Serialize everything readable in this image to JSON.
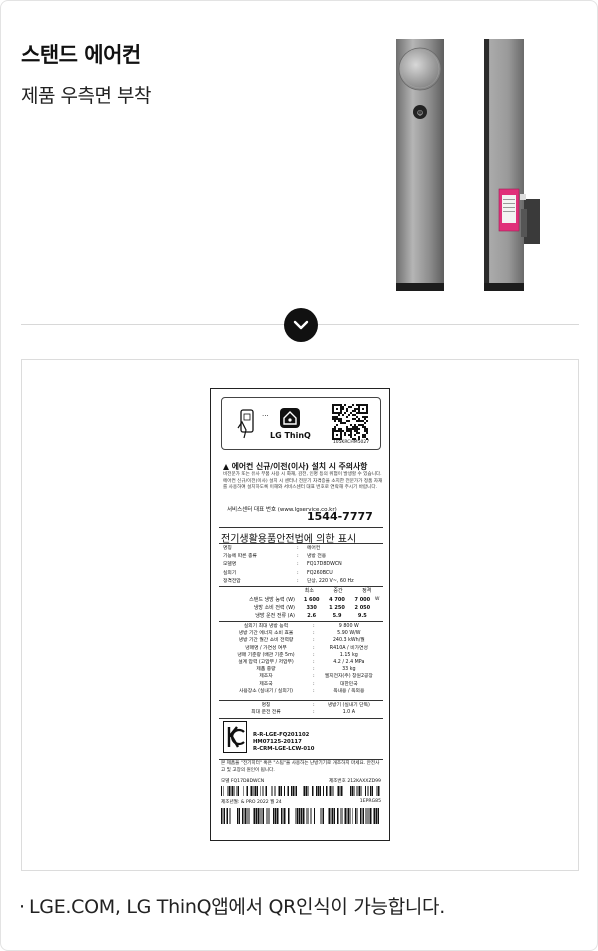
{
  "header": {
    "title": "스탠드 에어컨",
    "subtitle": "제품 우측면 부착"
  },
  "label": {
    "thinq_brand": "LG ThinQ",
    "qr_id": "105KRCHM5027",
    "caution_title": "에어컨 신규/이전(이사) 설치 시 주의사항",
    "caution_body": "비전문가 또는 유사 부품 사용 시 화재, 감전, 인명 등의 위험이 발생할 수 있습니다. 에어컨 신규/이전(이사) 설치 시 센터나 전문기 자격증을 소지한 전문가가 정품 자재를 사용하여 설치하도록 이해와 서비스센터 대표 번호로 연락해 주시기 바랍니다.",
    "service_label": "서비스센터 대표 번호 (www.lgservice.co.kr)",
    "service_phone": "1544-7777",
    "spec_title": "전기생활용품안전법에 의한 표시",
    "specs": [
      {
        "k": "명칭",
        "v": "에어컨"
      },
      {
        "k": "기능에 따른 종류",
        "v": "냉방 전용"
      },
      {
        "k": "모델명",
        "v": "FQ17D8DWCN"
      },
      {
        "k": "실외기",
        "v": "FQ260BCU"
      },
      {
        "k": "정격전압",
        "v": "단상, 220 V~, 60 Hz"
      }
    ],
    "perf_head": [
      "최소",
      "중간",
      "정격"
    ],
    "perf_rows": [
      {
        "k": "스탠드 냉방 능력 (W)",
        "v": [
          "1 600",
          "4 700",
          "7 000"
        ],
        "u": "W"
      },
      {
        "k": "냉방 소비 전력 (W)",
        "v": [
          "330",
          "1 250",
          "2 050"
        ],
        "u": ""
      },
      {
        "k": "냉방 운전 전류 (A)",
        "v": [
          "2.6",
          "5.9",
          "9.5"
        ],
        "u": ""
      }
    ],
    "details": [
      {
        "k": "실외기 최대 냉방 능력",
        "v": "9 800 W"
      },
      {
        "k": "냉방 기간 에너지 소비 효율",
        "v": "5.90 W/W"
      },
      {
        "k": "냉방 기간 월간 소비 전력량",
        "v": "240.3 kWh/월"
      },
      {
        "k": "냉매명 / 가연성 여부",
        "v": "R410A / 비가연성"
      },
      {
        "k": "냉매 기준량 (배관 기준 5m)",
        "v": "1.15 kg"
      },
      {
        "k": "설계 압력 (고압부 / 저압부)",
        "v": "4.2 / 2.4 MPa"
      },
      {
        "k": "제품 중량",
        "v": "33 kg"
      },
      {
        "k": "제조자",
        "v": "엘지전자(주) 창원2공장"
      },
      {
        "k": "제조국",
        "v": "대한민국"
      },
      {
        "k": "사용장소 (실내기 / 실외기)",
        "v": "옥내용 / 옥외용"
      }
    ],
    "makers": [
      {
        "k": "명칭",
        "v": "냉방기 (실내기 단독)"
      },
      {
        "k": "최대 운전 전류",
        "v": "1.0 A"
      }
    ],
    "certs": [
      "R-R-LGE-FQ201102",
      "HM07125-20117",
      "R-CRM-LGE-LCW-010"
    ],
    "notice": "본 제품을 \"전기히터\" 혹은 \"스팀\"을 사용하는 난방기기로 개조하지 마세요. 안전사고 및 고장의 원인이 됩니다.",
    "model_left": "모델 FQ17D8DWCN",
    "model_right": "제조번호 212KAXXZD99",
    "mfg_left": "제조년월: & PRO 2022 월 24",
    "mfg_right": "1EPRG85"
  },
  "footnote": "LGE.COM, LG ThinQ앱에서 QR인식이 가능합니다.",
  "colors": {
    "unit_body": "#9b9b9b",
    "unit_dark": "#5a5a5a",
    "accent_pink": "#e0307a",
    "toggle": "#111111"
  }
}
